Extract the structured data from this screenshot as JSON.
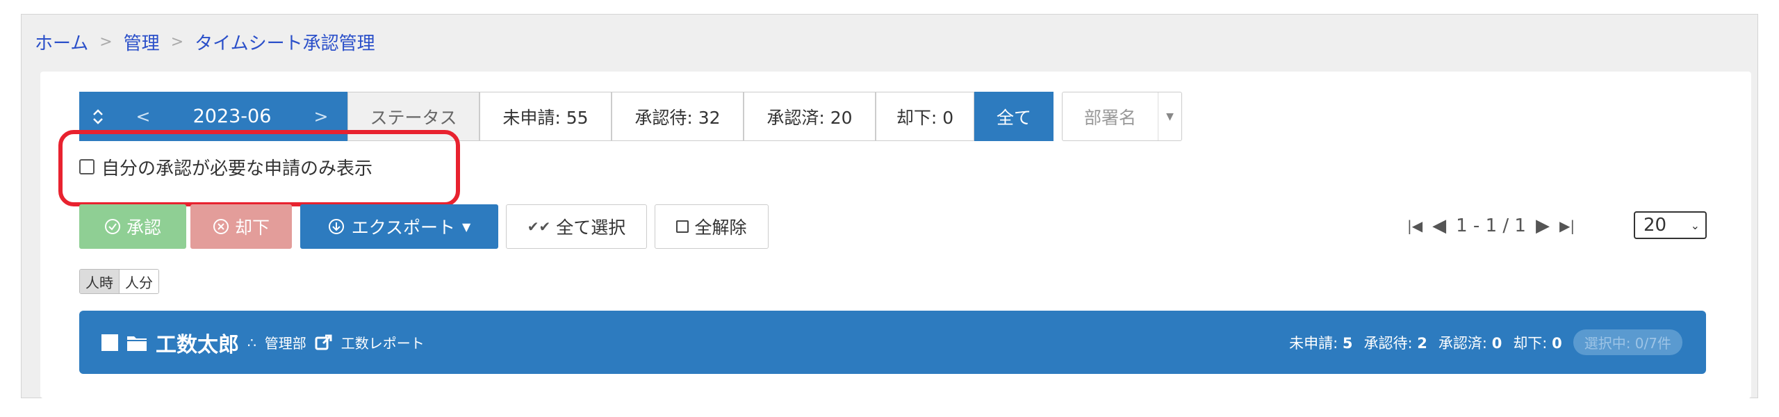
{
  "breadcrumb": {
    "home": "ホーム",
    "admin": "管理",
    "current": "タイムシート承認管理",
    "sep": ">"
  },
  "toolbar": {
    "sort_icon": "sort-icon",
    "prev": "<",
    "month": "2023-06",
    "next": ">",
    "status_label": "ステータス",
    "filters": [
      {
        "label": "未申請: 55"
      },
      {
        "label": "承認待: 32"
      },
      {
        "label": "承認済: 20"
      },
      {
        "label": "却下: 0"
      },
      {
        "label": "全て"
      }
    ],
    "dept_placeholder": "部署名",
    "dept_arrow": "▼"
  },
  "filter_check": {
    "label": "自分の承認が必要な申請のみ表示"
  },
  "actions": {
    "approve": "承認",
    "reject": "却下",
    "export": "エクスポート",
    "select_all": "全て選択",
    "deselect_all": "全解除"
  },
  "pager": {
    "first": "⏮",
    "prev": "◀",
    "range": "1 - 1 / 1",
    "next": "▶",
    "last": "⏭",
    "per_page": "20"
  },
  "unit_toggle": {
    "person_hour": "人時",
    "person_minute": "人分"
  },
  "user_row": {
    "name": "工数太郎",
    "department": "管理部",
    "report_link": "工数レポート",
    "stats": {
      "unsubmitted_label": "未申請:",
      "unsubmitted": "5",
      "waiting_label": "承認待:",
      "waiting": "2",
      "approved_label": "承認済:",
      "approved": "0",
      "rejected_label": "却下:",
      "rejected": "0",
      "selected": "選択中: 0/7件"
    }
  },
  "colors": {
    "primary": "#2d7bbf",
    "approve": "#8fcf94",
    "reject": "#e39d9a",
    "highlight": "#e8222f",
    "link": "#2a4fc9"
  }
}
